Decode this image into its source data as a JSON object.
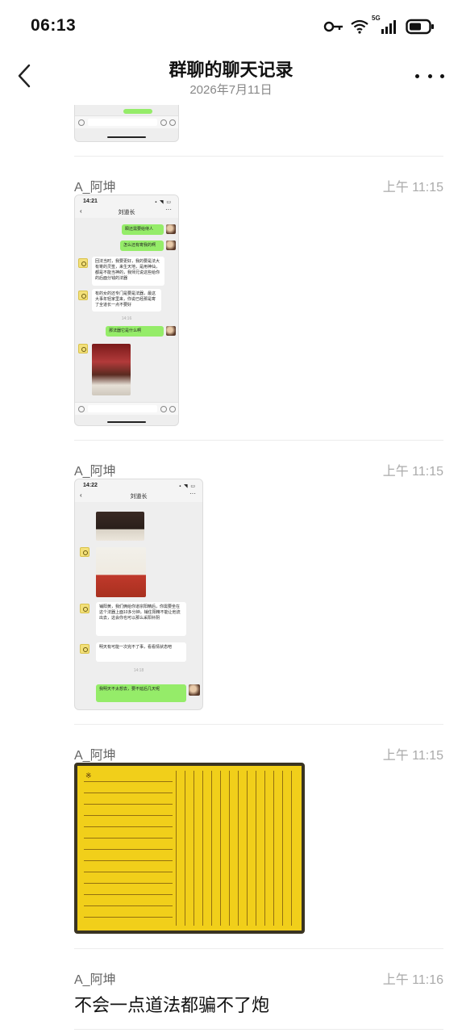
{
  "status_bar": {
    "time": "06:13",
    "network": "5G",
    "icons": [
      "key-icon",
      "wifi-icon",
      "signal-icon",
      "battery-icon"
    ]
  },
  "header": {
    "title": "群聊的聊天记录",
    "date": "2026年7月11日",
    "back_icon": "chevron-left-icon",
    "more_icon": "more-dots-icon"
  },
  "messages": [
    {
      "sender": "A_阿坤",
      "time": "上午 11:15",
      "type": "image",
      "screenshot": {
        "status_time": "14:21",
        "chat_title": "刘道长",
        "bubbles": [
          {
            "side": "right",
            "text": "瞬还需要给侍人"
          },
          {
            "side": "right",
            "text": "怎么还有寄我的啊"
          },
          {
            "side": "left",
            "text": "回法当时，我要更好，我的要是法大有寄的灵签，来生天地，是用神仙，都是不能当神的，我师兄说这些给你的后面分钱的法器"
          },
          {
            "side": "left",
            "text": "有的女的还专门是要是法器，最这大事年轻家里来，你说已经那是寄了全道长一点不要好"
          },
          {
            "side": "right",
            "text": "那法器它是什么啊"
          }
        ],
        "timestamp": "14:16"
      }
    },
    {
      "sender": "A_阿坤",
      "time": "上午 11:15",
      "type": "image",
      "screenshot": {
        "status_time": "14:22",
        "chat_title": "刘道长",
        "bubbles": [
          {
            "side": "left",
            "text": "铺阳黄，我们俩给你道宗阳精后，你需要坐在这个法器上面10多分钟，铺住阳精不能让他流出去，这会你也可以那么采阳补阴"
          },
          {
            "side": "left",
            "text": "明天有可能一次完不了事，看看情状态吧"
          },
          {
            "side": "right",
            "text": "我明天不太想去，要不延后几天呢"
          }
        ],
        "timestamp": "14:18"
      }
    },
    {
      "sender": "A_阿坤",
      "time": "上午 11:15",
      "type": "image",
      "image_desc_icon": "talisman-paper-image"
    },
    {
      "sender": "A_阿坤",
      "time": "上午 11:16",
      "type": "text",
      "text": "不会一点道法都骗不了炮"
    }
  ]
}
